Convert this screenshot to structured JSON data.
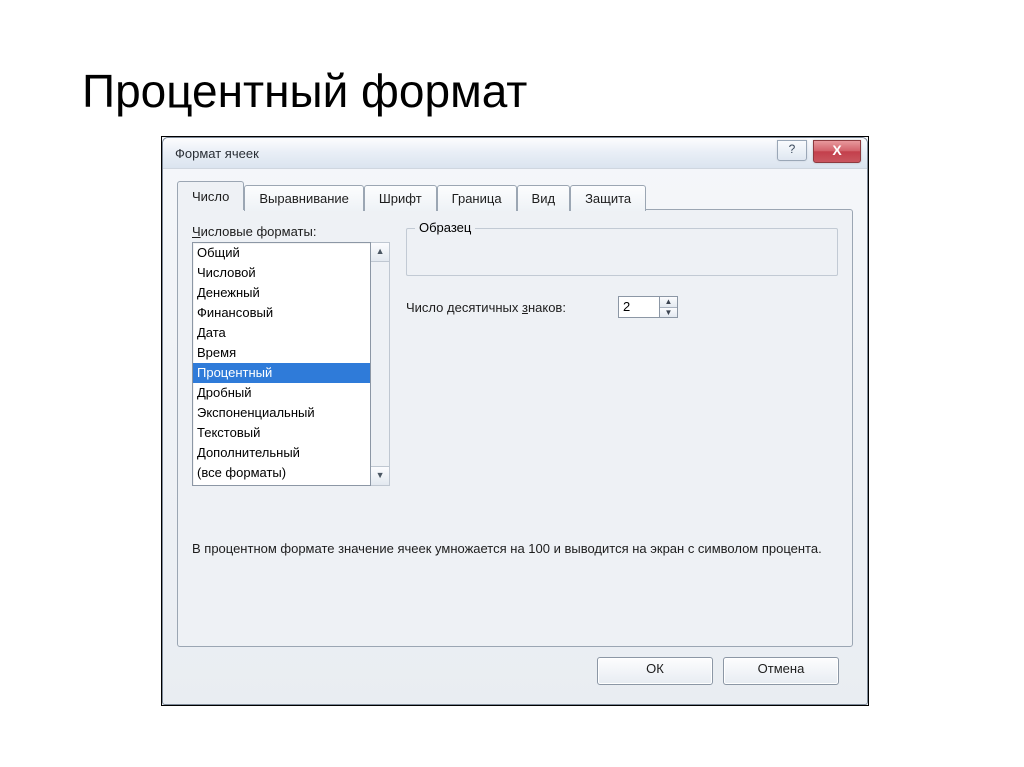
{
  "slide": {
    "title": "Процентный формат"
  },
  "dialog": {
    "title": "Формат ячеек",
    "help_glyph": "?",
    "close_glyph": "X",
    "tabs": [
      {
        "label": "Число"
      },
      {
        "label": "Выравнивание"
      },
      {
        "label": "Шрифт"
      },
      {
        "label": "Граница"
      },
      {
        "label": "Вид"
      },
      {
        "label": "Защита"
      }
    ],
    "list_label": "Числовые форматы:",
    "list_items": [
      {
        "label": "Общий"
      },
      {
        "label": "Числовой"
      },
      {
        "label": "Денежный"
      },
      {
        "label": "Финансовый"
      },
      {
        "label": "Дата"
      },
      {
        "label": "Время"
      },
      {
        "label": "Процентный",
        "selected": true
      },
      {
        "label": "Дробный"
      },
      {
        "label": "Экспоненциальный"
      },
      {
        "label": "Текстовый"
      },
      {
        "label": "Дополнительный"
      },
      {
        "label": "(все форматы)"
      }
    ],
    "sample_group": "Образец",
    "decimals_label_pre": "Число десятичных ",
    "decimals_label_mnemonic": "з",
    "decimals_label_post": "наков:",
    "decimals_value": "2",
    "description": "В процентном формате значение ячеек умножается на 100 и выводится на экран с символом процента.",
    "ok": "ОК",
    "cancel": "Отмена",
    "arrow_up": "▲",
    "arrow_down": "▼"
  }
}
